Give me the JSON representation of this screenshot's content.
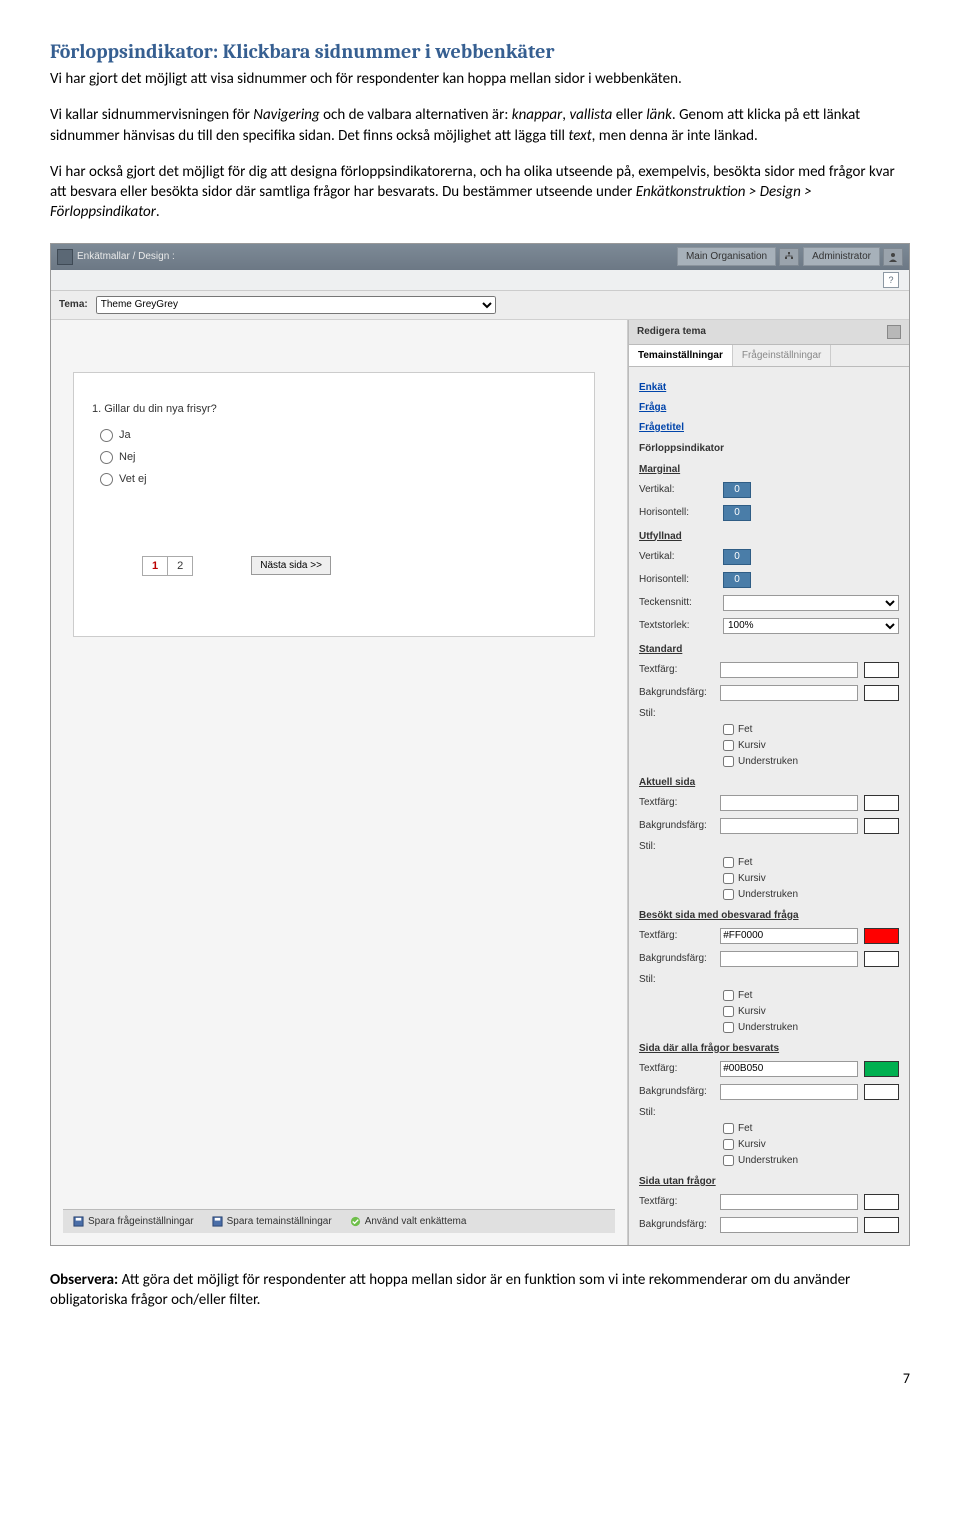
{
  "doc": {
    "heading": "Förloppsindikator: Klickbara sidnummer i webbenkäter",
    "p1_a": "Vi har gjort det möjligt att visa sidnummer och för respondenter kan hoppa mellan sidor i webbenkäten.",
    "p2_a": "Vi kallar sidnummervisningen för ",
    "p2_nav": "Navigering",
    "p2_b": " och de valbara alternativen är: ",
    "p2_knappar": "knappar",
    "p2_c": ", ",
    "p2_vallista": "vallista",
    "p2_d": " eller ",
    "p2_lank": "länk",
    "p2_e": ". Genom att klicka på ett länkat sidnummer hänvisas du till den specifika sidan. Det finns också möjlighet att lägga till ",
    "p2_text": "text",
    "p2_f": ", men denna är inte länkad.",
    "p3_a": "Vi har också gjort det möjligt för dig att designa förloppsindikatorerna, och ha olika utseende på, exempelvis, besökta sidor med frågor kvar att besvara eller besökta sidor där samtliga frågor har besvarats. Du bestämmer utseende under ",
    "p3_path": "Enkätkonstruktion > Design > Förloppsindikator",
    "p3_b": ".",
    "obs_a": "Observera:",
    "obs_b": " Att göra det möjligt för respondenter att hoppa mellan sidor är en funktion som vi inte rekommenderar om du använder obligatoriska frågor och/eller filter.",
    "page_number": "7"
  },
  "app": {
    "breadcrumb": "Enkätmallar / Design :",
    "main_org_btn": "Main Organisation",
    "admin_btn": "Administrator",
    "tema_label": "Tema:",
    "tema_value": "Theme GreyGrey",
    "help_icon_sym": "?",
    "survey": {
      "question_num": "1. ",
      "question": "Gillar du din nya frisyr?",
      "opt1": "Ja",
      "opt2": "Nej",
      "opt3": "Vet ej",
      "page1": "1",
      "page2": "2",
      "next": "Nästa sida >>"
    },
    "footer": {
      "b1": "Spara frågeinställningar",
      "b2": "Spara temainställningar",
      "b3": "Använd valt enkättema"
    },
    "side": {
      "head": "Redigera tema",
      "tab1": "Temainställningar",
      "tab2": "Frågeinställningar",
      "links": {
        "enkat": "Enkät",
        "fraga": "Fråga",
        "fragetitel": "Frågetitel"
      },
      "forloppsindikator": "Förloppsindikator",
      "marginal": "Marginal",
      "vertikal": "Vertikal:",
      "horisontell": "Horisontell:",
      "zero": "0",
      "utfyllnad": "Utfyllnad",
      "teckensnitt": "Teckensnitt:",
      "textstorlek": "Textstorlek:",
      "textstorlek_val": "100%",
      "standard": "Standard",
      "textfarg": "Textfärg:",
      "bakgrundsfarg": "Bakgrundsfärg:",
      "stil": "Stil:",
      "fet": "Fet",
      "kursiv": "Kursiv",
      "understruken": "Understruken",
      "aktuell_sida": "Aktuell sida",
      "besokt_obesvarad": "Besökt sida med obesvarad fråga",
      "red_hex": "#FF0000",
      "alla_besvarats": "Sida där alla frågor besvarats",
      "green_hex": "#00B050",
      "utan_fragor": "Sida utan frågor"
    }
  },
  "colors": {
    "red": "#FF0000",
    "green": "#00B050",
    "white": "#FFFFFF"
  }
}
